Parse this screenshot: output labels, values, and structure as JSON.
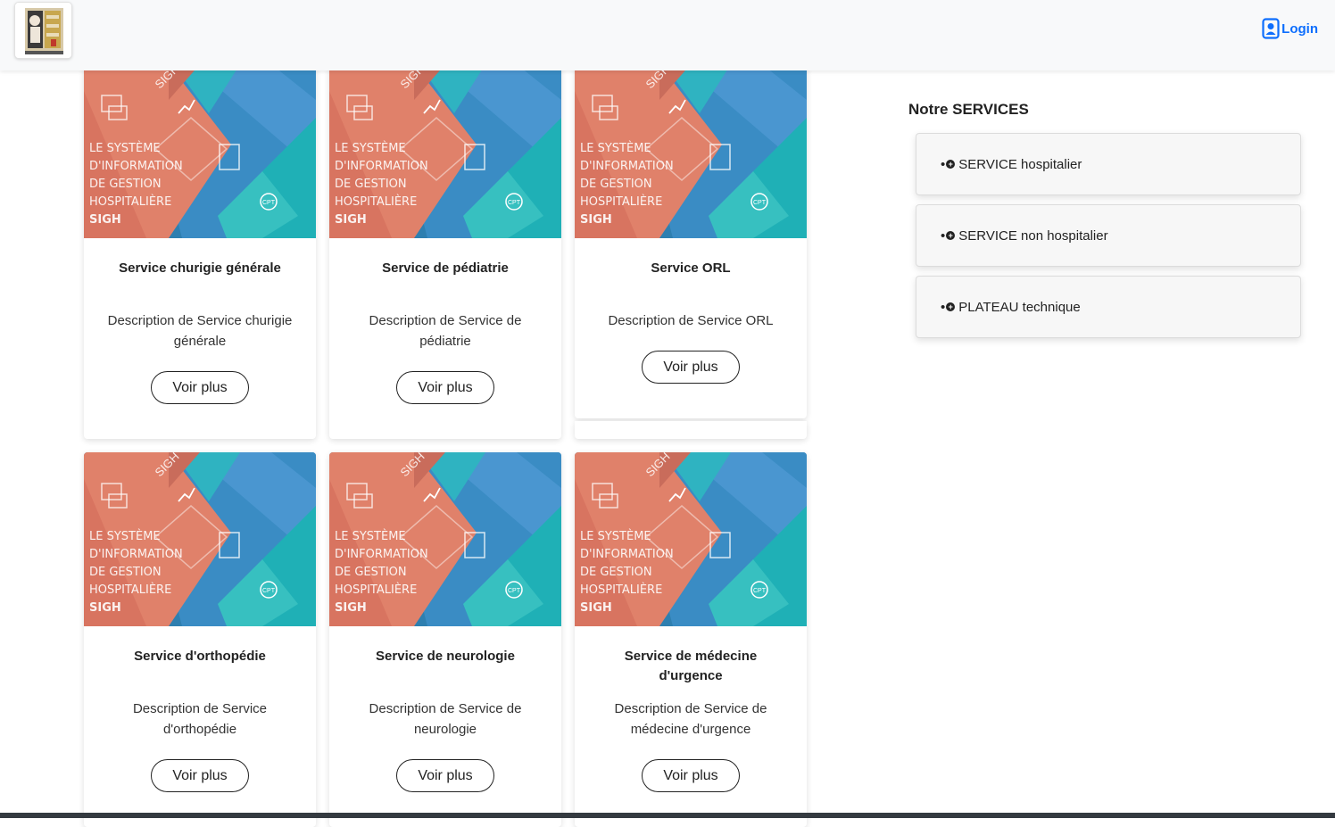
{
  "header": {
    "login_label": "Login",
    "accent_color": "#0d6efd"
  },
  "banner": {
    "line1": "LE SYSTÈME",
    "line2": "D'INFORMATION",
    "line3": "DE GESTION",
    "line4": "HOSPITALIÈRE",
    "line5": "SIGH",
    "tag": "SIGH",
    "badge": "CPT"
  },
  "cards": [
    {
      "title": "Service churigie générale",
      "desc1": "Description de Service churigie",
      "desc2": "générale",
      "button": "Voir plus"
    },
    {
      "title": "Service de pédiatrie",
      "desc1": "Description de Service de",
      "desc2": "pédiatrie",
      "button": "Voir plus"
    },
    {
      "title": "Service ORL",
      "desc1": "Description de Service ORL",
      "desc2": "",
      "button": "Voir plus"
    },
    {
      "title": "Service d'orthopédie",
      "desc1": "Description de Service",
      "desc2": "d'orthopédie",
      "button": "Voir plus"
    },
    {
      "title": "Service de neurologie",
      "desc1": "Description de Service de",
      "desc2": "neurologie",
      "button": "Voir plus"
    },
    {
      "title1": "Service de médecine",
      "title2": "d'urgence",
      "desc1": "Description de Service de",
      "desc2": "médecine d'urgence",
      "button": "Voir plus"
    }
  ],
  "sidebar": {
    "title": "Notre SERVICES",
    "items": [
      {
        "label": "SERVICE hospitalier"
      },
      {
        "label": "SERVICE non hospitalier"
      },
      {
        "label": "PLATEAU technique"
      }
    ]
  }
}
